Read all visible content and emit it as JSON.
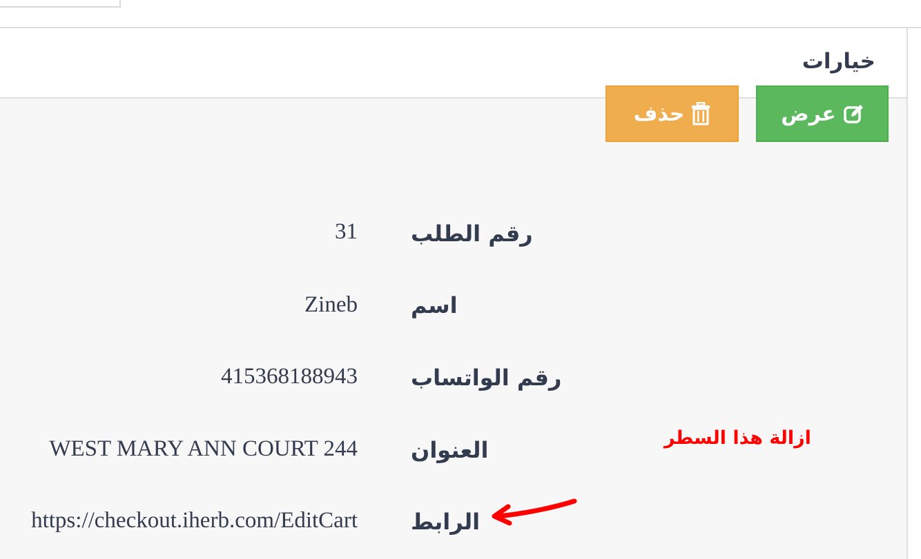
{
  "panel": {
    "title": "خيارات"
  },
  "actions": {
    "view_label": "عرض",
    "delete_label": "حذف",
    "view_icon": "edit-icon",
    "delete_icon": "trash-icon",
    "view_color": "#5cb85c",
    "delete_color": "#f0ad4e"
  },
  "details": [
    {
      "label": "رقم الطلب",
      "value": "31"
    },
    {
      "label": "اسم",
      "value": "Zineb"
    },
    {
      "label": "رقم الواتساب",
      "value": "415368188943"
    },
    {
      "label": "العنوان",
      "value": "WEST MARY ANN COURT 244"
    },
    {
      "label": "الرابط",
      "value": "https://checkout.iherb.com/EditCart"
    }
  ],
  "annotation": {
    "text": "ازالة هذا السطر",
    "color": "#ff0000"
  }
}
